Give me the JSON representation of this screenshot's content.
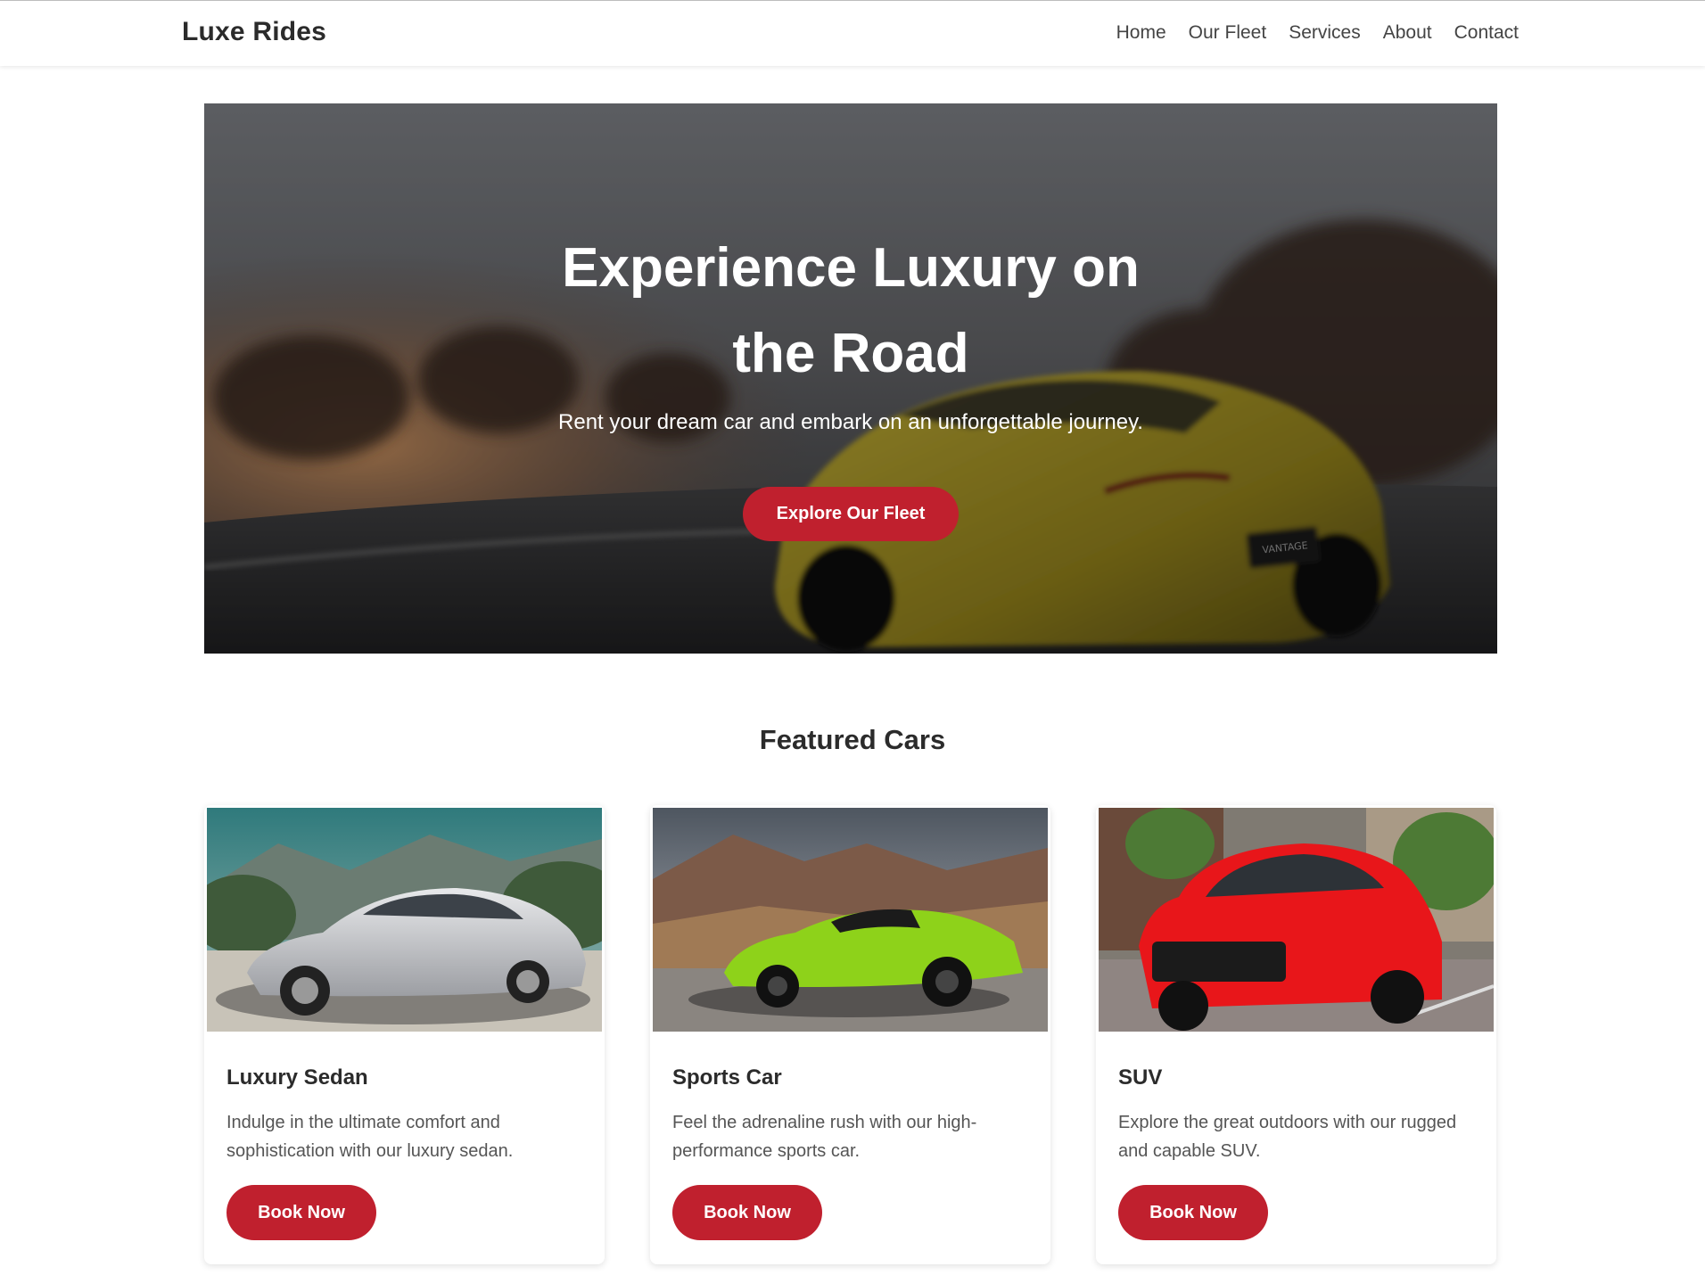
{
  "header": {
    "brand": "Luxe Rides",
    "nav": [
      "Home",
      "Our Fleet",
      "Services",
      "About",
      "Contact"
    ]
  },
  "hero": {
    "title": "Experience Luxury on the Road",
    "subtitle": "Rent your dream car and embark on an unforgettable journey.",
    "cta": "Explore Our Fleet",
    "badge_text": "VANTAGE"
  },
  "featured": {
    "title": "Featured Cars",
    "cards": [
      {
        "title": "Luxury Sedan",
        "description": "Indulge in the ultimate comfort and sophistication with our luxury sedan.",
        "button": "Book Now"
      },
      {
        "title": "Sports Car",
        "description": "Feel the adrenaline rush with our high-performance sports car.",
        "button": "Book Now"
      },
      {
        "title": "SUV",
        "description": "Explore the great outdoors with our rugged and capable SUV.",
        "button": "Book Now"
      }
    ]
  },
  "colors": {
    "accent": "#c0202e",
    "text": "#2b2b2b",
    "muted": "#555555"
  }
}
